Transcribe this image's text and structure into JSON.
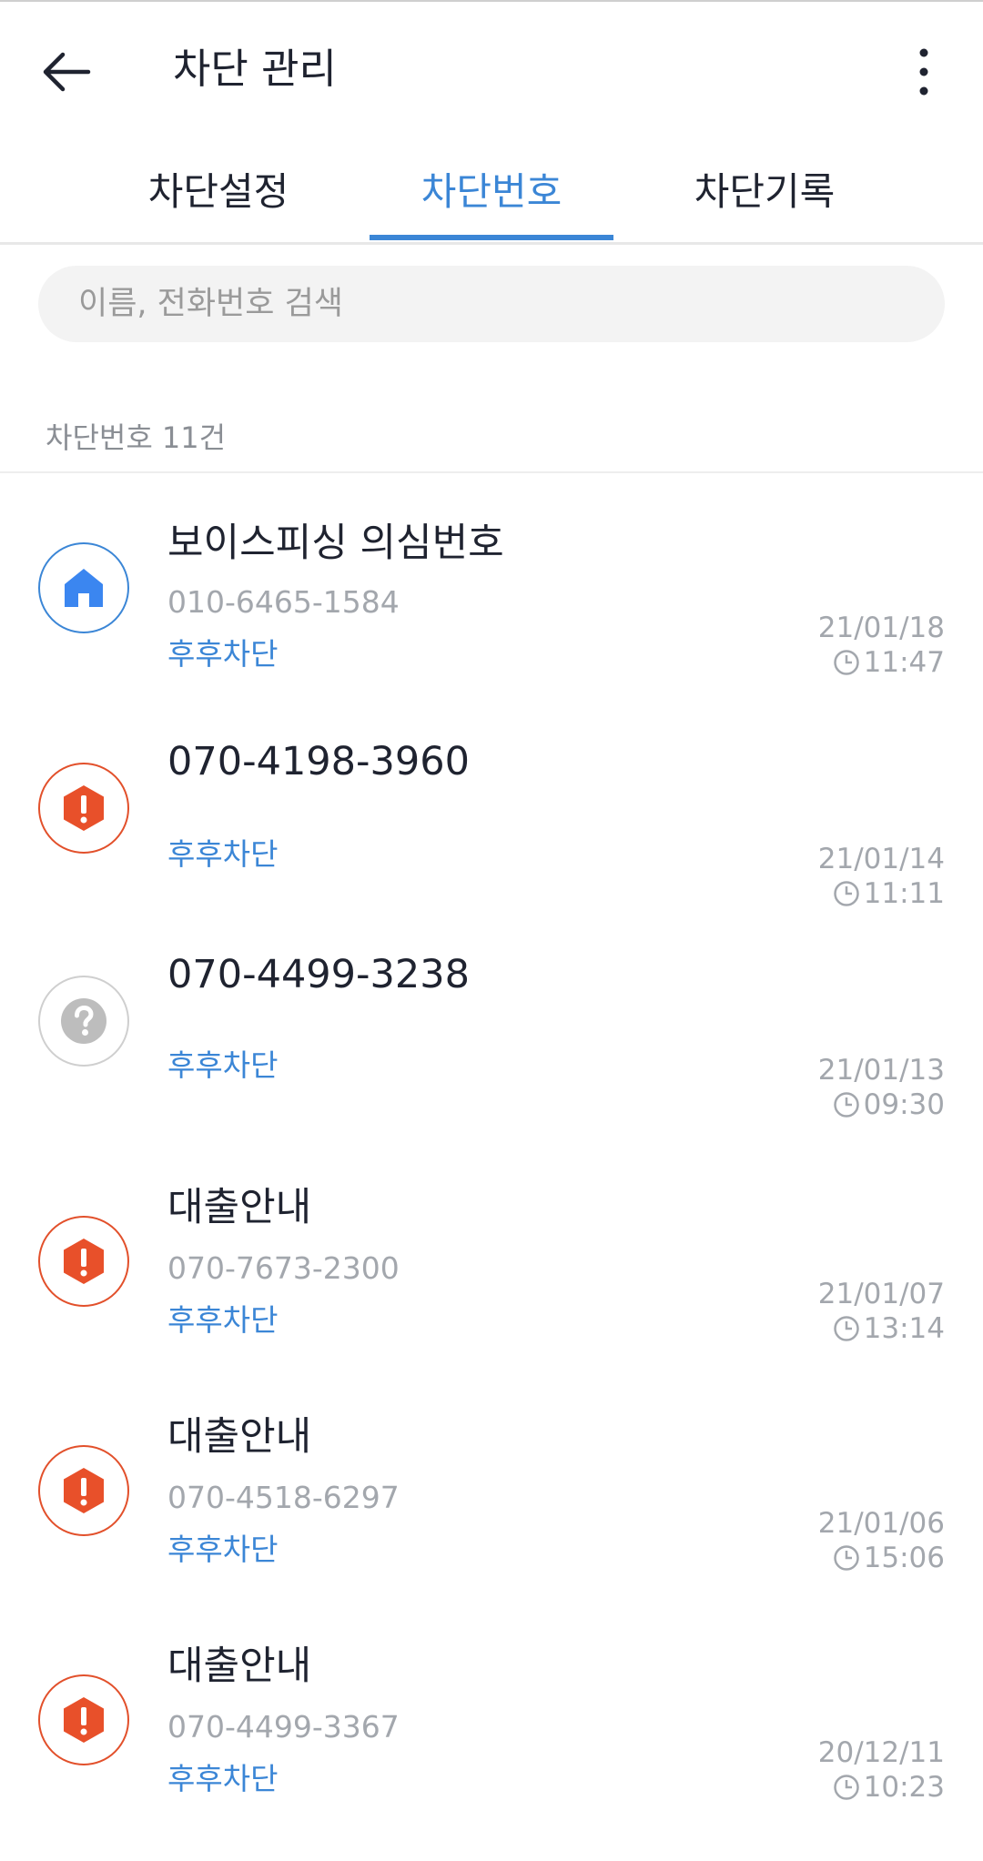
{
  "header": {
    "title": "차단 관리"
  },
  "tabs": [
    {
      "label": "차단설정",
      "active": false
    },
    {
      "label": "차단번호",
      "active": true
    },
    {
      "label": "차단기록",
      "active": false
    }
  ],
  "search": {
    "placeholder": "이름, 전화번호 검색"
  },
  "list_count": "차단번호 11건",
  "colors": {
    "accent": "#3b86d6",
    "warning": "#e2502b",
    "unknown": "#bdbdbd"
  },
  "items": [
    {
      "icon": "home-icon",
      "name": "보이스피싱 의심번호",
      "number": "010-6465-1584",
      "status": "후후차단",
      "date": "21/01/18",
      "time": "11:47"
    },
    {
      "icon": "warning-icon",
      "name": "070-4198-3960",
      "number": "",
      "status": "후후차단",
      "date": "21/01/14",
      "time": "11:11"
    },
    {
      "icon": "question-icon",
      "name": "070-4499-3238",
      "number": "",
      "status": "후후차단",
      "date": "21/01/13",
      "time": "09:30"
    },
    {
      "icon": "warning-icon",
      "name": "대출안내",
      "number": "070-7673-2300",
      "status": "후후차단",
      "date": "21/01/07",
      "time": "13:14"
    },
    {
      "icon": "warning-icon",
      "name": "대출안내",
      "number": "070-4518-6297",
      "status": "후후차단",
      "date": "21/01/06",
      "time": "15:06"
    },
    {
      "icon": "warning-icon",
      "name": "대출안내",
      "number": "070-4499-3367",
      "status": "후후차단",
      "date": "20/12/11",
      "time": "10:23"
    }
  ]
}
